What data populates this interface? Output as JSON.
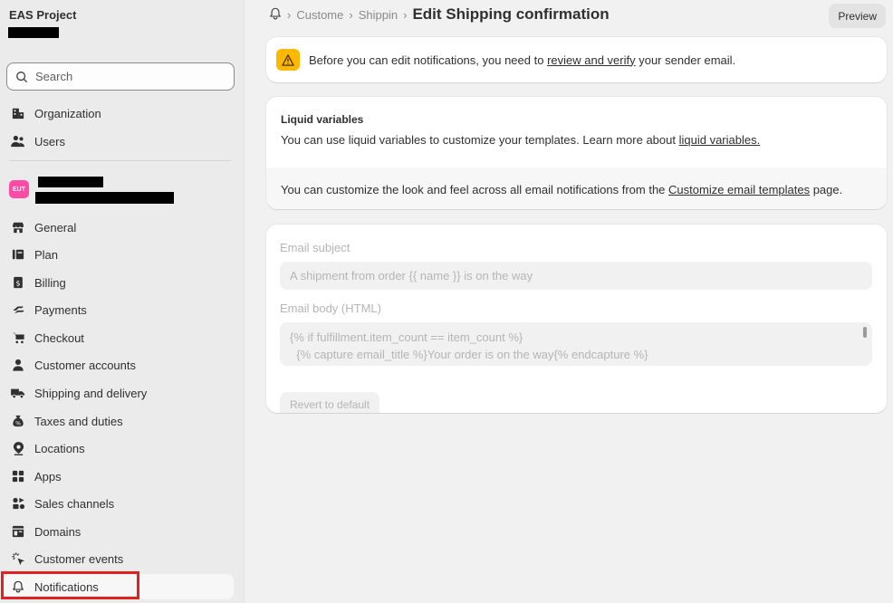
{
  "sidebar": {
    "store_name": "EAS Project",
    "search_placeholder": "Search",
    "store_badge": "EUT",
    "top_items": [
      {
        "label": "Organization",
        "icon": "organization-icon"
      },
      {
        "label": "Users",
        "icon": "users-icon"
      }
    ],
    "items": [
      {
        "label": "General",
        "icon": "store-icon"
      },
      {
        "label": "Plan",
        "icon": "plan-icon"
      },
      {
        "label": "Billing",
        "icon": "billing-icon"
      },
      {
        "label": "Payments",
        "icon": "payments-icon"
      },
      {
        "label": "Checkout",
        "icon": "cart-icon"
      },
      {
        "label": "Customer accounts",
        "icon": "person-icon"
      },
      {
        "label": "Shipping and delivery",
        "icon": "truck-icon"
      },
      {
        "label": "Taxes and duties",
        "icon": "taxes-icon"
      },
      {
        "label": "Locations",
        "icon": "location-pin-icon"
      },
      {
        "label": "Apps",
        "icon": "apps-icon"
      },
      {
        "label": "Sales channels",
        "icon": "sales-channels-icon"
      },
      {
        "label": "Domains",
        "icon": "domains-icon"
      },
      {
        "label": "Customer events",
        "icon": "cursor-click-icon"
      },
      {
        "label": "Notifications",
        "icon": "bell-icon"
      }
    ]
  },
  "header": {
    "crumb_1": "Custome",
    "crumb_2": "Shippin",
    "title": "Edit Shipping confirmation",
    "preview_label": "Preview"
  },
  "banner": {
    "text_before": "Before you can edit notifications, you need to ",
    "link": "review and verify",
    "text_after": " your sender email."
  },
  "liquid": {
    "title": "Liquid variables",
    "text": "You can use liquid variables to customize your templates. Learn more about ",
    "link": "liquid variables.",
    "customize_text": "You can customize the look and feel across all email notifications from the ",
    "customize_link": "Customize email templates",
    "customize_after": " page."
  },
  "editor": {
    "subject_label": "Email subject",
    "subject_value": "A shipment from order {{ name }} is on the way",
    "body_label": "Email body (HTML)",
    "body_line_1": "{% if fulfillment.item_count == item_count %}",
    "body_line_2": "  {% capture email_title %}Your order is on the way{% endcapture %}",
    "revert_label": "Revert to default"
  }
}
